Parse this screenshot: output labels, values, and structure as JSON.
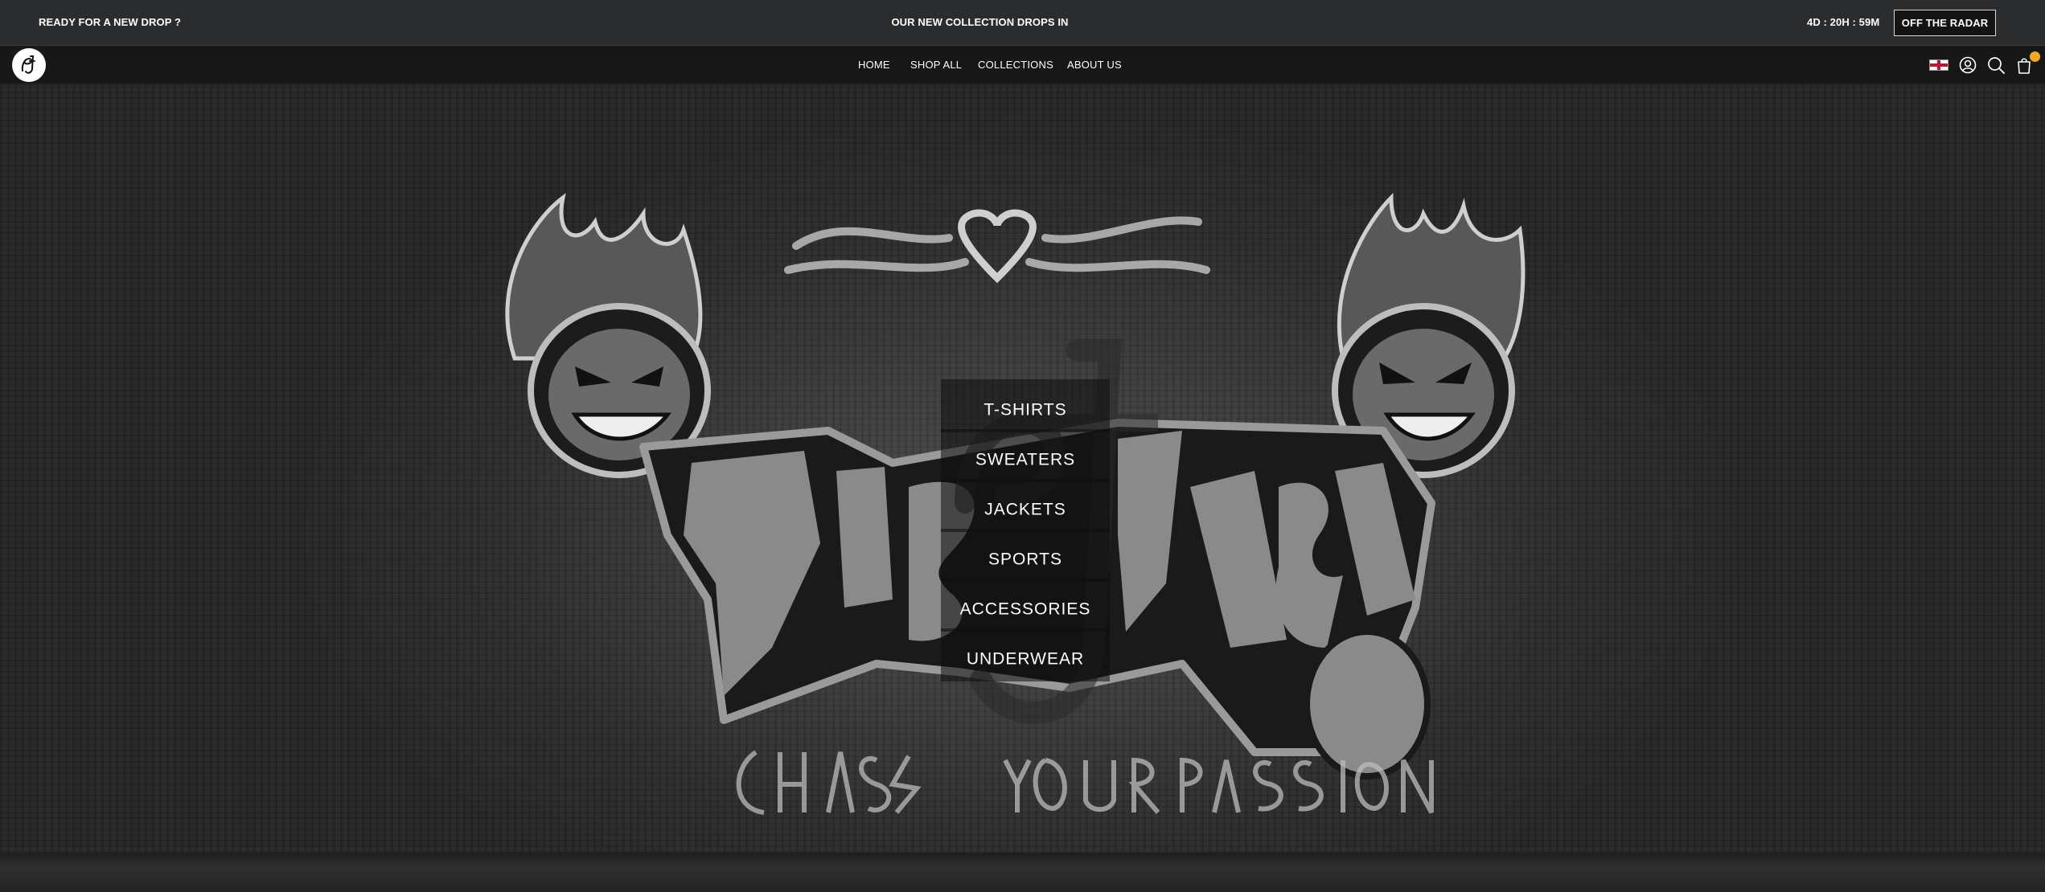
{
  "announcement": {
    "left_prefix": "READY FOR A NEW ",
    "left_emphasis": "DROP",
    "left_suffix": " ?",
    "center": "OUR NEW COLLECTION DROPS IN",
    "countdown": "4D : 20H : 59M",
    "button_label": "OFF THE RADAR"
  },
  "header": {
    "nav": [
      {
        "label": "HOME"
      },
      {
        "label": "SHOP ALL"
      },
      {
        "label": "COLLECTIONS"
      },
      {
        "label": "ABOUT US"
      }
    ],
    "icons": [
      "logo-icon",
      "flag-icon",
      "account-icon",
      "search-icon",
      "cart-icon"
    ],
    "cart_badge_color": "#f2a91d"
  },
  "hero": {
    "categories": [
      {
        "label": "T-SHIRTS"
      },
      {
        "label": "SWEATERS"
      },
      {
        "label": "JACKETS"
      },
      {
        "label": "SPORTS"
      },
      {
        "label": "ACCESSORIES"
      },
      {
        "label": "UNDERWEAR"
      }
    ]
  },
  "colors": {
    "announcement_bg": "#2b2c2e",
    "header_bg": "#171717",
    "text": "#ffffff",
    "accent": "#f2a91d"
  }
}
